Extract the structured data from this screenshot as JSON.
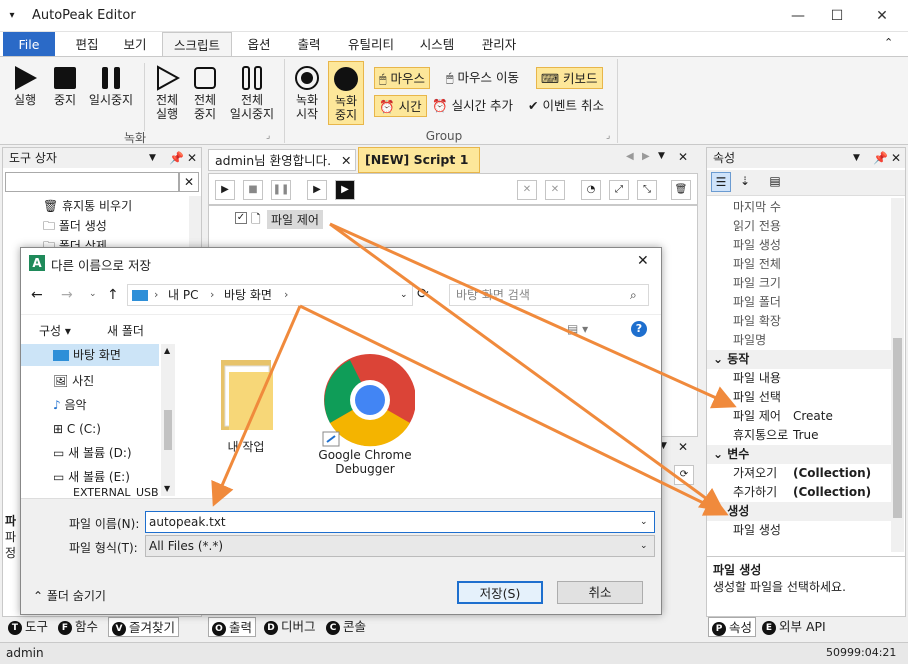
{
  "window": {
    "app_menu_glyph": "▾",
    "title": "AutoPeak Editor",
    "min": "—",
    "max": "☐",
    "close": "✕"
  },
  "ribbon_tabs": [
    "File",
    "편집",
    "보기",
    "스크립트",
    "옵션",
    "출력",
    "유틸리티",
    "시스템",
    "관리자"
  ],
  "ribbon_collapse": "⌃",
  "ribbon": {
    "rec_group": {
      "label": "녹화",
      "buttons": [
        {
          "label1": "실행",
          "label2": ""
        },
        {
          "label1": "중지",
          "label2": ""
        },
        {
          "label1": "일시중지",
          "label2": ""
        },
        {
          "label1": "전체",
          "label2": "실행"
        },
        {
          "label1": "전체",
          "label2": "중지"
        },
        {
          "label1": "전체",
          "label2": "일시중지"
        }
      ]
    },
    "group": {
      "label": "Group",
      "rec_start": {
        "label1": "녹화",
        "label2": "시작"
      },
      "rec_stop": {
        "label1": "녹화",
        "label2": "중지"
      },
      "mouse": "마우스",
      "mouse_move": "마우스 이동",
      "keyboard": "키보드",
      "time": "시간",
      "realtime_add": "실시간 추가",
      "event_cancel": "이벤트 취소"
    }
  },
  "toolbox": {
    "title": "도구 상자",
    "items": [
      "휴지통 비우기",
      "폴더 생성",
      "폴더 삭제"
    ],
    "bottom_label1": "파",
    "bottom_label2": "파",
    "bottom_label3": "정",
    "tabs": [
      {
        "key": "T",
        "label": "도구"
      },
      {
        "key": "F",
        "label": "함수"
      },
      {
        "key": "V",
        "label": "즐겨찾기"
      }
    ]
  },
  "editor": {
    "tabs": [
      "admin님 환영합니다.",
      "[NEW] Script 1"
    ],
    "script_line": "파일 제어",
    "bottom_tabs": [
      {
        "key": "O",
        "label": "출력"
      },
      {
        "key": "D",
        "label": "디버그"
      },
      {
        "key": "C",
        "label": "콘솔"
      }
    ]
  },
  "properties": {
    "title": "속성",
    "rows_top": [
      "마지막 수",
      "읽기 전용",
      "파일 생성",
      "파일 전체",
      "파일 크기",
      "파일 폴더",
      "파일 확장",
      "파일명"
    ],
    "cat_action": "동작",
    "action_rows": [
      {
        "name": "파일 내용",
        "value": ""
      },
      {
        "name": "파일 선택",
        "value": ""
      },
      {
        "name": "파일 제어",
        "value": "Create"
      },
      {
        "name": "휴지통으로",
        "value": "True"
      }
    ],
    "cat_var": "변수",
    "var_rows": [
      {
        "name": "가져오기",
        "value": "(Collection)"
      },
      {
        "name": "추가하기",
        "value": "(Collection)"
      }
    ],
    "cat_create": "생성",
    "create_rows": [
      {
        "name": "파일 생성",
        "value": ""
      }
    ],
    "desc_title": "파일 생성",
    "desc_text": "생성할 파일을 선택하세요.",
    "tabs": [
      {
        "key": "P",
        "label": "속성"
      },
      {
        "key": "E",
        "label": "외부 API"
      }
    ]
  },
  "statusbar": {
    "user": "admin",
    "time": "50999:04:21"
  },
  "dialog": {
    "title": "다른 이름으로 저장",
    "breadcrumb": [
      "내 PC",
      "바탕 화면"
    ],
    "search_placeholder": "바탕 화면 검색",
    "organize": "구성 ▾",
    "new_folder": "새 폴더",
    "nav_items": [
      "바탕 화면",
      "사진",
      "음악",
      "C (C:)",
      "새 볼륨 (D:)",
      "새 볼륨 (E:)",
      "EXTERNAL_USB"
    ],
    "files": [
      {
        "name": "내 작업"
      },
      {
        "name": "Google Chrome Debugger"
      }
    ],
    "filename_label": "파일 이름(N):",
    "filename_value": "autopeak.txt",
    "filetype_label": "파일 형식(T):",
    "filetype_value": "All Files (*.*)",
    "hide_folders": "폴더 숨기기",
    "save": "저장(S)",
    "cancel": "취소"
  },
  "colors": {
    "accent": "#2b6ac7",
    "highlight": "#fde79a",
    "arrow": "#f08a3c"
  }
}
